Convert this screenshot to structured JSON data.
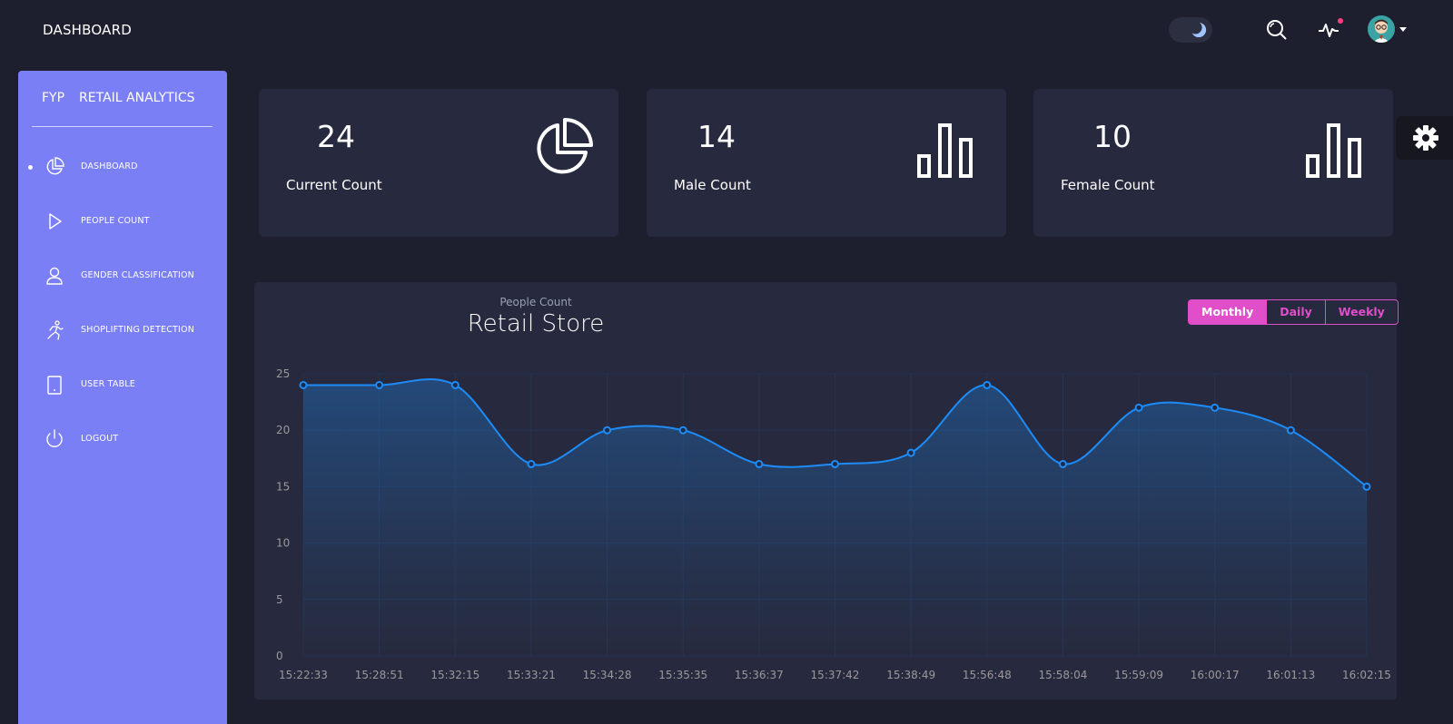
{
  "header": {
    "title": "DASHBOARD",
    "icons": [
      "moon-icon",
      "search-icon",
      "activity-icon",
      "avatar"
    ]
  },
  "sidebar": {
    "brand_short": "FYP",
    "brand_long": "RETAIL ANALYTICS",
    "items": [
      {
        "label": "DASHBOARD",
        "icon": "pie-chart-icon",
        "active": true
      },
      {
        "label": "PEOPLE COUNT",
        "icon": "play-icon",
        "active": false
      },
      {
        "label": "GENDER CLASSIFICATION",
        "icon": "user-icon",
        "active": false
      },
      {
        "label": "SHOPLIFTING DETECTION",
        "icon": "running-icon",
        "active": false
      },
      {
        "label": "USER TABLE",
        "icon": "tablet-icon",
        "active": false
      },
      {
        "label": "LOGOUT",
        "icon": "power-icon",
        "active": false
      }
    ]
  },
  "cards": [
    {
      "value": "24",
      "label": "Current Count",
      "icon": "pie-chart-icon"
    },
    {
      "value": "14",
      "label": "Male Count",
      "icon": "bar-chart-icon"
    },
    {
      "value": "10",
      "label": "Female Count",
      "icon": "bar-chart-icon"
    }
  ],
  "chart_panel": {
    "subtitle": "People Count",
    "title": "Retail Store",
    "buttons": [
      {
        "label": "Monthly",
        "active": true
      },
      {
        "label": "Daily",
        "active": false
      },
      {
        "label": "Weekly",
        "active": false
      }
    ]
  },
  "colors": {
    "background": "#1e1f2e",
    "card": "#272a3e",
    "sidebar": "#7b7ff6",
    "accent": "#e14eca",
    "line": "#1d8cf8",
    "notification": "#ff3e7f"
  },
  "chart_data": {
    "type": "line",
    "title": "Retail Store",
    "subtitle": "People Count",
    "x": [
      "15:22:33",
      "15:28:51",
      "15:32:15",
      "15:33:21",
      "15:34:28",
      "15:35:35",
      "15:36:37",
      "15:37:42",
      "15:38:49",
      "15:56:48",
      "15:58:04",
      "15:59:09",
      "16:00:17",
      "16:01:13",
      "16:02:15"
    ],
    "values": [
      24,
      24,
      24,
      17,
      20,
      20,
      17,
      17,
      18,
      24,
      17,
      22,
      22,
      20,
      15
    ],
    "ylim": [
      0,
      25
    ],
    "yticks": [
      0,
      5,
      10,
      15,
      20,
      25
    ],
    "grid": true,
    "area_fill": true,
    "smooth": true
  }
}
